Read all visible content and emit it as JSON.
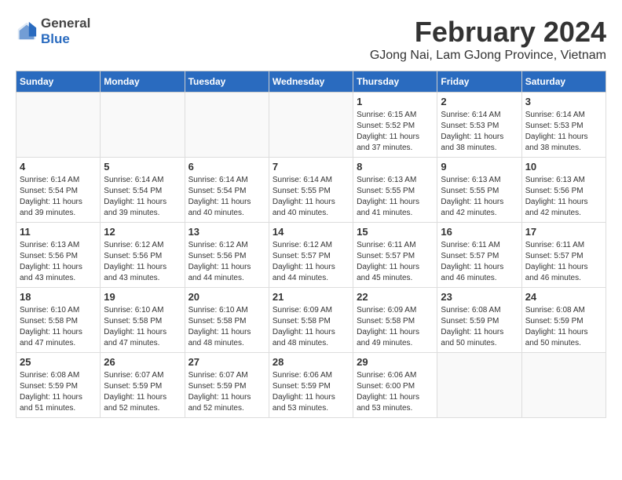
{
  "header": {
    "logo_general": "General",
    "logo_blue": "Blue",
    "main_title": "February 2024",
    "subtitle": "GJong Nai, Lam GJong Province, Vietnam"
  },
  "calendar": {
    "days_of_week": [
      "Sunday",
      "Monday",
      "Tuesday",
      "Wednesday",
      "Thursday",
      "Friday",
      "Saturday"
    ],
    "weeks": [
      [
        {
          "day": "",
          "info": ""
        },
        {
          "day": "",
          "info": ""
        },
        {
          "day": "",
          "info": ""
        },
        {
          "day": "",
          "info": ""
        },
        {
          "day": "1",
          "info": "Sunrise: 6:15 AM\nSunset: 5:52 PM\nDaylight: 11 hours and 37 minutes."
        },
        {
          "day": "2",
          "info": "Sunrise: 6:14 AM\nSunset: 5:53 PM\nDaylight: 11 hours and 38 minutes."
        },
        {
          "day": "3",
          "info": "Sunrise: 6:14 AM\nSunset: 5:53 PM\nDaylight: 11 hours and 38 minutes."
        }
      ],
      [
        {
          "day": "4",
          "info": "Sunrise: 6:14 AM\nSunset: 5:54 PM\nDaylight: 11 hours and 39 minutes."
        },
        {
          "day": "5",
          "info": "Sunrise: 6:14 AM\nSunset: 5:54 PM\nDaylight: 11 hours and 39 minutes."
        },
        {
          "day": "6",
          "info": "Sunrise: 6:14 AM\nSunset: 5:54 PM\nDaylight: 11 hours and 40 minutes."
        },
        {
          "day": "7",
          "info": "Sunrise: 6:14 AM\nSunset: 5:55 PM\nDaylight: 11 hours and 40 minutes."
        },
        {
          "day": "8",
          "info": "Sunrise: 6:13 AM\nSunset: 5:55 PM\nDaylight: 11 hours and 41 minutes."
        },
        {
          "day": "9",
          "info": "Sunrise: 6:13 AM\nSunset: 5:55 PM\nDaylight: 11 hours and 42 minutes."
        },
        {
          "day": "10",
          "info": "Sunrise: 6:13 AM\nSunset: 5:56 PM\nDaylight: 11 hours and 42 minutes."
        }
      ],
      [
        {
          "day": "11",
          "info": "Sunrise: 6:13 AM\nSunset: 5:56 PM\nDaylight: 11 hours and 43 minutes."
        },
        {
          "day": "12",
          "info": "Sunrise: 6:12 AM\nSunset: 5:56 PM\nDaylight: 11 hours and 43 minutes."
        },
        {
          "day": "13",
          "info": "Sunrise: 6:12 AM\nSunset: 5:56 PM\nDaylight: 11 hours and 44 minutes."
        },
        {
          "day": "14",
          "info": "Sunrise: 6:12 AM\nSunset: 5:57 PM\nDaylight: 11 hours and 44 minutes."
        },
        {
          "day": "15",
          "info": "Sunrise: 6:11 AM\nSunset: 5:57 PM\nDaylight: 11 hours and 45 minutes."
        },
        {
          "day": "16",
          "info": "Sunrise: 6:11 AM\nSunset: 5:57 PM\nDaylight: 11 hours and 46 minutes."
        },
        {
          "day": "17",
          "info": "Sunrise: 6:11 AM\nSunset: 5:57 PM\nDaylight: 11 hours and 46 minutes."
        }
      ],
      [
        {
          "day": "18",
          "info": "Sunrise: 6:10 AM\nSunset: 5:58 PM\nDaylight: 11 hours and 47 minutes."
        },
        {
          "day": "19",
          "info": "Sunrise: 6:10 AM\nSunset: 5:58 PM\nDaylight: 11 hours and 47 minutes."
        },
        {
          "day": "20",
          "info": "Sunrise: 6:10 AM\nSunset: 5:58 PM\nDaylight: 11 hours and 48 minutes."
        },
        {
          "day": "21",
          "info": "Sunrise: 6:09 AM\nSunset: 5:58 PM\nDaylight: 11 hours and 48 minutes."
        },
        {
          "day": "22",
          "info": "Sunrise: 6:09 AM\nSunset: 5:58 PM\nDaylight: 11 hours and 49 minutes."
        },
        {
          "day": "23",
          "info": "Sunrise: 6:08 AM\nSunset: 5:59 PM\nDaylight: 11 hours and 50 minutes."
        },
        {
          "day": "24",
          "info": "Sunrise: 6:08 AM\nSunset: 5:59 PM\nDaylight: 11 hours and 50 minutes."
        }
      ],
      [
        {
          "day": "25",
          "info": "Sunrise: 6:08 AM\nSunset: 5:59 PM\nDaylight: 11 hours and 51 minutes."
        },
        {
          "day": "26",
          "info": "Sunrise: 6:07 AM\nSunset: 5:59 PM\nDaylight: 11 hours and 52 minutes."
        },
        {
          "day": "27",
          "info": "Sunrise: 6:07 AM\nSunset: 5:59 PM\nDaylight: 11 hours and 52 minutes."
        },
        {
          "day": "28",
          "info": "Sunrise: 6:06 AM\nSunset: 5:59 PM\nDaylight: 11 hours and 53 minutes."
        },
        {
          "day": "29",
          "info": "Sunrise: 6:06 AM\nSunset: 6:00 PM\nDaylight: 11 hours and 53 minutes."
        },
        {
          "day": "",
          "info": ""
        },
        {
          "day": "",
          "info": ""
        }
      ]
    ]
  }
}
